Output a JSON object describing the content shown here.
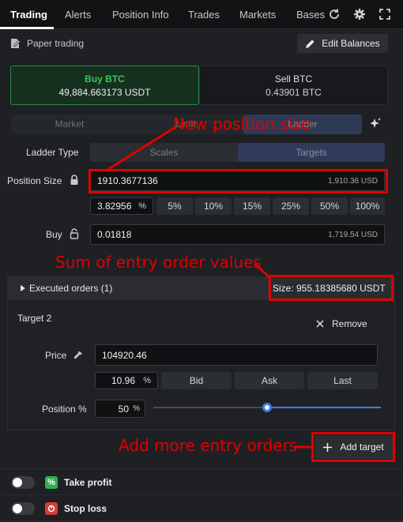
{
  "tabs": [
    {
      "label": "Trading",
      "active": true
    },
    {
      "label": "Alerts"
    },
    {
      "label": "Position Info"
    },
    {
      "label": "Trades"
    },
    {
      "label": "Markets"
    },
    {
      "label": "Bases"
    }
  ],
  "top_icons": [
    "refresh-icon",
    "gear-icon",
    "expand-icon"
  ],
  "paper": {
    "label": "Paper trading",
    "edit_label": "Edit Balances"
  },
  "side": {
    "buy_title": "Buy BTC",
    "buy_amount": "49,884.663173 USDT",
    "sell_title": "Sell BTC",
    "sell_amount": "0.43901 BTC"
  },
  "order_types": [
    "Market",
    "Limit",
    "Ladder"
  ],
  "ladder": {
    "label": "Ladder Type",
    "options": [
      "Scales",
      "Targets"
    ],
    "selected": "Targets"
  },
  "position_size": {
    "label": "Position Size",
    "value": "1910.3677136",
    "hint": "1,910.36 USD"
  },
  "percent": {
    "value": "3.82956",
    "unit": "%",
    "presets": [
      "5%",
      "10%",
      "15%",
      "25%",
      "50%",
      "100%"
    ]
  },
  "buy": {
    "label": "Buy",
    "value": "0.01818",
    "hint": "1,719.54 USD"
  },
  "executed": {
    "label": "Executed orders (1)",
    "size": "Size: 955.18385680 USDT"
  },
  "target": {
    "title": "Target 2",
    "remove_label": "Remove",
    "price_label": "Price",
    "price_value": "104920.46",
    "price_pct": "10.96",
    "price_pct_unit": "%",
    "price_buttons": [
      "Bid",
      "Ask",
      "Last"
    ],
    "position_label": "Position %",
    "position_value": "50",
    "position_unit": "%",
    "position_level": 0.5
  },
  "add_target_label": "Add target",
  "take_profit_label": "Take profit",
  "stop_loss_label": "Stop loss",
  "annotations": {
    "new_position": "New position size",
    "sum_entry": "Sum of entry order values",
    "add_more": "Add more entry orders"
  },
  "colors": {
    "accent_blue": "#3b7bea",
    "buy_green": "#3ec25b",
    "annotation_red": "#e00000"
  }
}
